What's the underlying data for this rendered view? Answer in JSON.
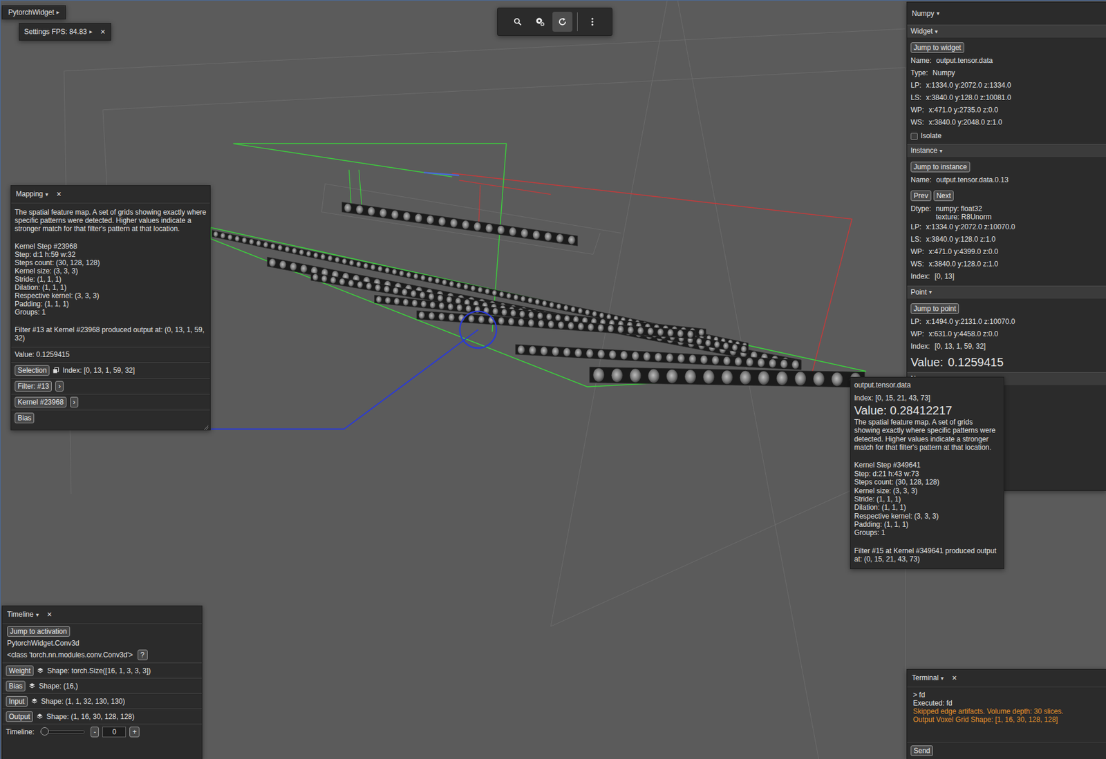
{
  "app_menu": {
    "label": "PytorchWidget",
    "caret": "▸"
  },
  "settings": {
    "label": "Settings FPS: 84.83",
    "caret": "▸",
    "close": "×"
  },
  "toolbar": [
    {
      "selected": false
    },
    {
      "selected": false
    },
    {
      "selected": true
    },
    {
      "selected": false
    }
  ],
  "inspector": {
    "title": "Numpy",
    "caret": "▾",
    "sections": [
      {
        "title": "Widget",
        "caret": "▾",
        "button": "Jump to widget",
        "rows": [
          {
            "kind": "field",
            "label": "Name:",
            "value": "output.tensor.data"
          },
          {
            "kind": "field",
            "label": "Type:",
            "value": "Numpy"
          },
          {
            "kind": "field",
            "label": "LP:",
            "value": "x:1334.0 y:2072.0 z:1334.0"
          },
          {
            "kind": "field",
            "label": "LS:",
            "value": "x:3840.0 y:128.0 z:10081.0"
          },
          {
            "kind": "field",
            "label": "WP:",
            "value": "x:471.0 y:2735.0 z:0.0"
          },
          {
            "kind": "field",
            "label": "WS:",
            "value": "x:3840.0 y:2048.0 z:1.0"
          },
          {
            "kind": "checkbox",
            "label": "Isolate",
            "checked": false
          }
        ]
      },
      {
        "title": "Instance",
        "caret": "▾",
        "button": "Jump to instance",
        "rows": [
          {
            "kind": "field",
            "label": "Name:",
            "value": "output.tensor.data.0.13"
          },
          {
            "kind": "buttons",
            "buttons": [
              "Prev",
              "Next"
            ]
          },
          {
            "kind": "field",
            "label": "Dtype:",
            "value": [
              "numpy: float32",
              "texture: R8Unorm"
            ]
          },
          {
            "kind": "field",
            "label": "LP:",
            "value": "x:1334.0 y:2072.0 z:10070.0"
          },
          {
            "kind": "field",
            "label": "LS:",
            "value": "x:3840.0 y:128.0 z:1.0"
          },
          {
            "kind": "field",
            "label": "WP:",
            "value": "x:471.0 y:4399.0 z:0.0"
          },
          {
            "kind": "field",
            "label": "WS:",
            "value": "x:3840.0 y:128.0 z:1.0"
          },
          {
            "kind": "field",
            "label": "Index:",
            "value": "[0, 13]"
          }
        ]
      },
      {
        "title": "Point",
        "caret": "▾",
        "button": "Jump to point",
        "rows": [
          {
            "kind": "field",
            "label": "LP:",
            "value": "x:1494.0 y:2131.0 z:10070.0"
          },
          {
            "kind": "field",
            "label": "WP:",
            "value": "x:631.0 y:4458.0 z:0.0"
          },
          {
            "kind": "field",
            "label": "Index:",
            "value": "[0, 13, 1, 59, 32]"
          },
          {
            "kind": "value",
            "label": "Value:",
            "value": "0.1259415"
          }
        ]
      },
      {
        "title": "Numpy",
        "caret": "▾",
        "rows": []
      }
    ]
  },
  "mapping": {
    "title": "Mapping",
    "caret": "▾",
    "close": "×",
    "description": "The spatial feature map. A set of grids showing exactly where specific patterns were detected. Higher values indicate a stronger match for that filter's pattern at that location.",
    "details": [
      "Kernel Step #23968",
      "Step: d:1 h:59 w:32",
      "Steps count: (30, 128, 128)",
      "Kernel size: (3, 3, 3)",
      "Stride: (1, 1, 1)",
      "Dilation: (1, 1, 1)",
      "Respective kernel: (3, 3, 3)",
      "Padding: (1, 1, 1)",
      "Groups: 1"
    ],
    "result": "Filter #13 at Kernel #23968 produced output at: (0, 13, 1, 59, 32)",
    "value": "Value:  0.1259415",
    "selection": {
      "button": "Selection",
      "index": "Index:  [0, 13, 1, 59, 32]"
    },
    "links": [
      {
        "label": "Filter: #13",
        "arrow": "›"
      },
      {
        "label": "Kernel #23968",
        "arrow": "›"
      },
      {
        "label": "Bias"
      }
    ]
  },
  "tooltip": {
    "title": "output.tensor.data",
    "index": "Index: [0, 15, 21, 43, 73]",
    "value": "Value: 0.28412217",
    "description": "The spatial feature map. A set of grids showing exactly where specific patterns were detected. Higher values indicate a stronger match for that filter's pattern at that location.",
    "details": [
      "Kernel Step #349641",
      "Step: d:21 h:43 w:73",
      "Steps count: (30, 128, 128)",
      "Kernel size: (3, 3, 3)",
      "Stride: (1, 1, 1)",
      "Dilation: (1, 1, 1)",
      "Respective kernel: (3, 3, 3)",
      "Padding: (1, 1, 1)",
      "Groups: 1"
    ],
    "result": "Filter #15 at Kernel #349641 produced output at: (0, 15, 21, 43, 73)"
  },
  "timeline": {
    "title": "Timeline",
    "caret": "▾",
    "close": "×",
    "button": "Jump to activation",
    "module": "PytorchWidget.Conv3d",
    "class_name": "<class 'torch.nn.modules.conv.Conv3d'>",
    "help": "?",
    "tensors": [
      {
        "button": "Weight",
        "shape": "Shape: torch.Size([16, 1, 3, 3, 3])"
      },
      {
        "button": "Bias",
        "shape": "Shape: (16,)"
      },
      {
        "button": "Input",
        "shape": "Shape: (1, 1, 32, 130, 130)"
      },
      {
        "button": "Output",
        "shape": "Shape: (1, 16, 30, 128, 128)"
      }
    ],
    "slider": {
      "label": "Timeline:",
      "level": 0,
      "minus": "-",
      "value": "0",
      "plus": "+"
    }
  },
  "terminal": {
    "title": "Terminal",
    "caret": "▾",
    "close": "×",
    "lines": [
      {
        "text": "> fd",
        "color": "#e2e2e2"
      },
      {
        "text": "Executed: fd",
        "color": "#e2e2e2"
      },
      {
        "text": "Skipped edge artifacts. Volume depth: 30 slices.",
        "color": "#e8922c"
      },
      {
        "text": "Output Voxel Grid Shape: [1, 16, 30, 128, 128]",
        "color": "#e8922c"
      }
    ],
    "send": "Send"
  }
}
